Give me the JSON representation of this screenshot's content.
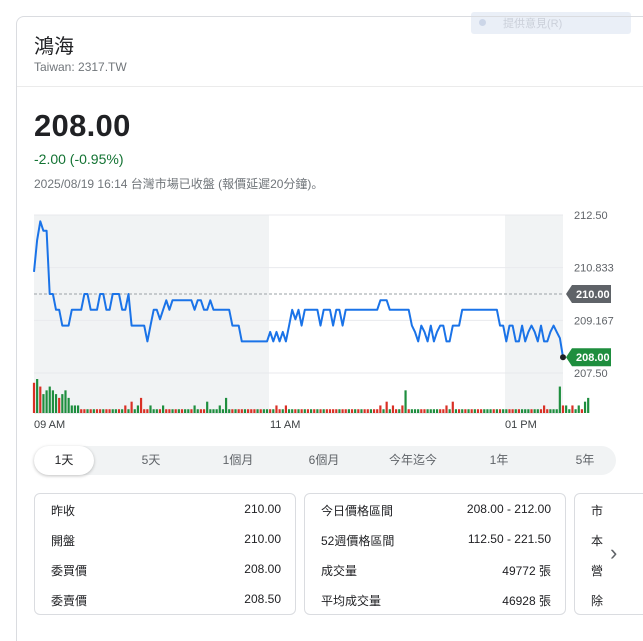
{
  "header": {
    "overlay_pill_text": "提供意見(R)",
    "company_name": "鴻海",
    "ticker": "Taiwan: 2317.TW"
  },
  "quote": {
    "price": "208.00",
    "change": "-2.00 (-0.95%)",
    "status": "2025/08/19 16:14 台灣市場已收盤 (報價延遲20分鐘)。",
    "change_color": "#137333"
  },
  "chart_data": {
    "type": "line",
    "x_labels": [
      "09 AM",
      "11 AM",
      "01 PM"
    ],
    "y_ticks": [
      "212.50",
      "210.833",
      "209.167",
      "207.50"
    ],
    "ylim": [
      207.5,
      212.5
    ],
    "prev_close": 210.0,
    "prev_close_label": "210.00",
    "last_label": "208.00",
    "line_color": "#1a73e8",
    "up_color": "#1e8e3e",
    "down_color": "#d93025",
    "prices": [
      210.7,
      211.7,
      212.3,
      212.0,
      212.0,
      210.0,
      210.0,
      209.5,
      209.5,
      209.0,
      209.0,
      209.0,
      209.5,
      209.5,
      209.5,
      209.5,
      210.0,
      210.0,
      209.5,
      209.5,
      209.5,
      210.0,
      210.0,
      209.5,
      209.5,
      210.0,
      210.0,
      210.0,
      209.5,
      209.5,
      210.0,
      209.0,
      209.0,
      209.0,
      209.0,
      209.0,
      208.5,
      209.0,
      209.5,
      209.5,
      209.2,
      209.5,
      209.8,
      209.5,
      209.8,
      209.8,
      209.8,
      209.8,
      209.8,
      209.8,
      209.8,
      209.5,
      209.8,
      209.8,
      209.5,
      209.5,
      209.8,
      209.5,
      209.5,
      209.5,
      209.5,
      209.5,
      209.5,
      209.0,
      209.0,
      209.0,
      208.5,
      208.5,
      208.5,
      208.5,
      208.5,
      208.5,
      208.5,
      208.5,
      208.5,
      208.8,
      208.5,
      208.8,
      208.5,
      208.8,
      208.5,
      209.0,
      209.5,
      209.2,
      209.5,
      209.0,
      209.5,
      209.5,
      209.5,
      209.5,
      209.5,
      209.0,
      209.5,
      209.5,
      209.5,
      209.0,
      209.5,
      209.5,
      209.0,
      209.5,
      209.5,
      209.5,
      209.5,
      209.5,
      209.5,
      209.5,
      209.5,
      209.5,
      209.5,
      209.5,
      209.8,
      209.8,
      209.8,
      209.5,
      209.5,
      209.5,
      209.5,
      209.5,
      209.5,
      209.5,
      209.0,
      208.8,
      208.5,
      209.0,
      208.8,
      208.5,
      209.0,
      208.5,
      208.8,
      209.0,
      209.0,
      208.5,
      208.5,
      209.0,
      209.0,
      209.0,
      209.5,
      209.5,
      209.5,
      209.5,
      209.5,
      209.5,
      209.5,
      209.5,
      209.5,
      209.5,
      209.5,
      209.5,
      209.0,
      209.0,
      208.5,
      209.0,
      209.0,
      208.5,
      208.5,
      209.0,
      208.5,
      208.8,
      209.0,
      208.8,
      208.5,
      209.0,
      208.5,
      208.5,
      208.8,
      209.0,
      208.8,
      208.6,
      208.0
    ],
    "volumes": [
      8,
      9,
      7,
      5,
      6,
      7,
      6,
      5,
      4,
      5,
      6,
      4,
      2,
      2,
      2,
      1,
      1,
      1,
      1,
      1,
      1,
      1,
      1,
      1,
      1,
      1,
      1,
      1,
      1,
      2,
      1,
      3,
      1,
      2,
      4,
      1,
      1,
      2,
      1,
      1,
      1,
      2,
      1,
      1,
      1,
      1,
      1,
      1,
      1,
      1,
      1,
      2,
      1,
      1,
      1,
      3,
      1,
      1,
      1,
      2,
      1,
      4,
      1,
      1,
      1,
      1,
      1,
      1,
      1,
      1,
      1,
      1,
      1,
      1,
      1,
      1,
      1,
      2,
      1,
      1,
      2,
      1,
      1,
      1,
      1,
      1,
      1,
      1,
      1,
      1,
      1,
      1,
      1,
      1,
      1,
      1,
      1,
      1,
      1,
      1,
      1,
      1,
      1,
      1,
      1,
      1,
      1,
      1,
      1,
      1,
      2,
      1,
      3,
      1,
      2,
      1,
      1,
      2,
      6,
      1,
      1,
      1,
      1,
      1,
      1,
      1,
      1,
      1,
      1,
      1,
      1,
      2,
      1,
      3,
      1,
      1,
      1,
      1,
      1,
      1,
      1,
      1,
      1,
      1,
      1,
      1,
      1,
      1,
      1,
      1,
      1,
      1,
      1,
      1,
      1,
      1,
      1,
      1,
      1,
      1,
      1,
      1,
      2,
      1,
      1,
      1,
      1,
      7,
      2,
      2,
      1,
      2,
      1,
      2,
      1,
      3,
      4
    ],
    "volume_colors": [
      "r",
      "g",
      "r",
      "g",
      "g",
      "g",
      "g",
      "g",
      "r",
      "g",
      "g",
      "g",
      "g",
      "g",
      "g",
      "r",
      "r",
      "g",
      "r",
      "g",
      "r",
      "r",
      "g",
      "r",
      "r",
      "g",
      "g",
      "r",
      "g",
      "r",
      "g",
      "r",
      "g",
      "g",
      "r",
      "r",
      "r",
      "g",
      "g",
      "g",
      "r",
      "g",
      "r",
      "r",
      "g",
      "r",
      "g",
      "r",
      "g",
      "g",
      "r",
      "g",
      "g",
      "r",
      "r",
      "g",
      "g",
      "g",
      "g",
      "g",
      "g",
      "g",
      "g",
      "r",
      "g",
      "r",
      "r",
      "g",
      "r",
      "r",
      "r",
      "g",
      "r",
      "g",
      "g",
      "r",
      "g",
      "r",
      "r",
      "g",
      "r",
      "g",
      "g",
      "r",
      "g",
      "r",
      "g",
      "r",
      "g",
      "r",
      "g",
      "r",
      "g",
      "r",
      "r",
      "r",
      "r",
      "g",
      "r",
      "r",
      "g",
      "r",
      "g",
      "r",
      "g",
      "r",
      "r",
      "g",
      "r",
      "r",
      "r",
      "g",
      "r",
      "g",
      "r",
      "r",
      "g",
      "r",
      "g",
      "r",
      "g",
      "g",
      "g",
      "r",
      "r",
      "g",
      "g",
      "g",
      "g",
      "r",
      "r",
      "r",
      "g",
      "r",
      "g",
      "r",
      "g",
      "r",
      "g",
      "r",
      "g",
      "r",
      "r",
      "g",
      "g",
      "g",
      "r",
      "g",
      "r",
      "g",
      "g",
      "r",
      "r",
      "g",
      "r",
      "g",
      "g",
      "g",
      "r",
      "g",
      "g",
      "r",
      "r",
      "r",
      "g",
      "g",
      "g",
      "g",
      "r",
      "g",
      "g",
      "r",
      "g",
      "g",
      "r",
      "g"
    ],
    "grid": true
  },
  "tabs": [
    "1天",
    "5天",
    "1個月",
    "6個月",
    "今年迄今",
    "1年",
    "5年"
  ],
  "stats": {
    "left": [
      {
        "label": "昨收",
        "value": "210.00"
      },
      {
        "label": "開盤",
        "value": "210.00"
      },
      {
        "label": "委買價",
        "value": "208.00"
      },
      {
        "label": "委賣價",
        "value": "208.50"
      }
    ],
    "middle": [
      {
        "label": "今日價格區間",
        "value": "208.00 - 212.00"
      },
      {
        "label": "52週價格區間",
        "value": "112.50 - 221.50"
      },
      {
        "label": "成交量",
        "value": "49772 張"
      },
      {
        "label": "平均成交量",
        "value": "46928 張"
      }
    ],
    "right": [
      {
        "label": "市"
      },
      {
        "label": "本"
      },
      {
        "label": "營"
      },
      {
        "label": "除"
      }
    ],
    "next_arrow": "›"
  }
}
